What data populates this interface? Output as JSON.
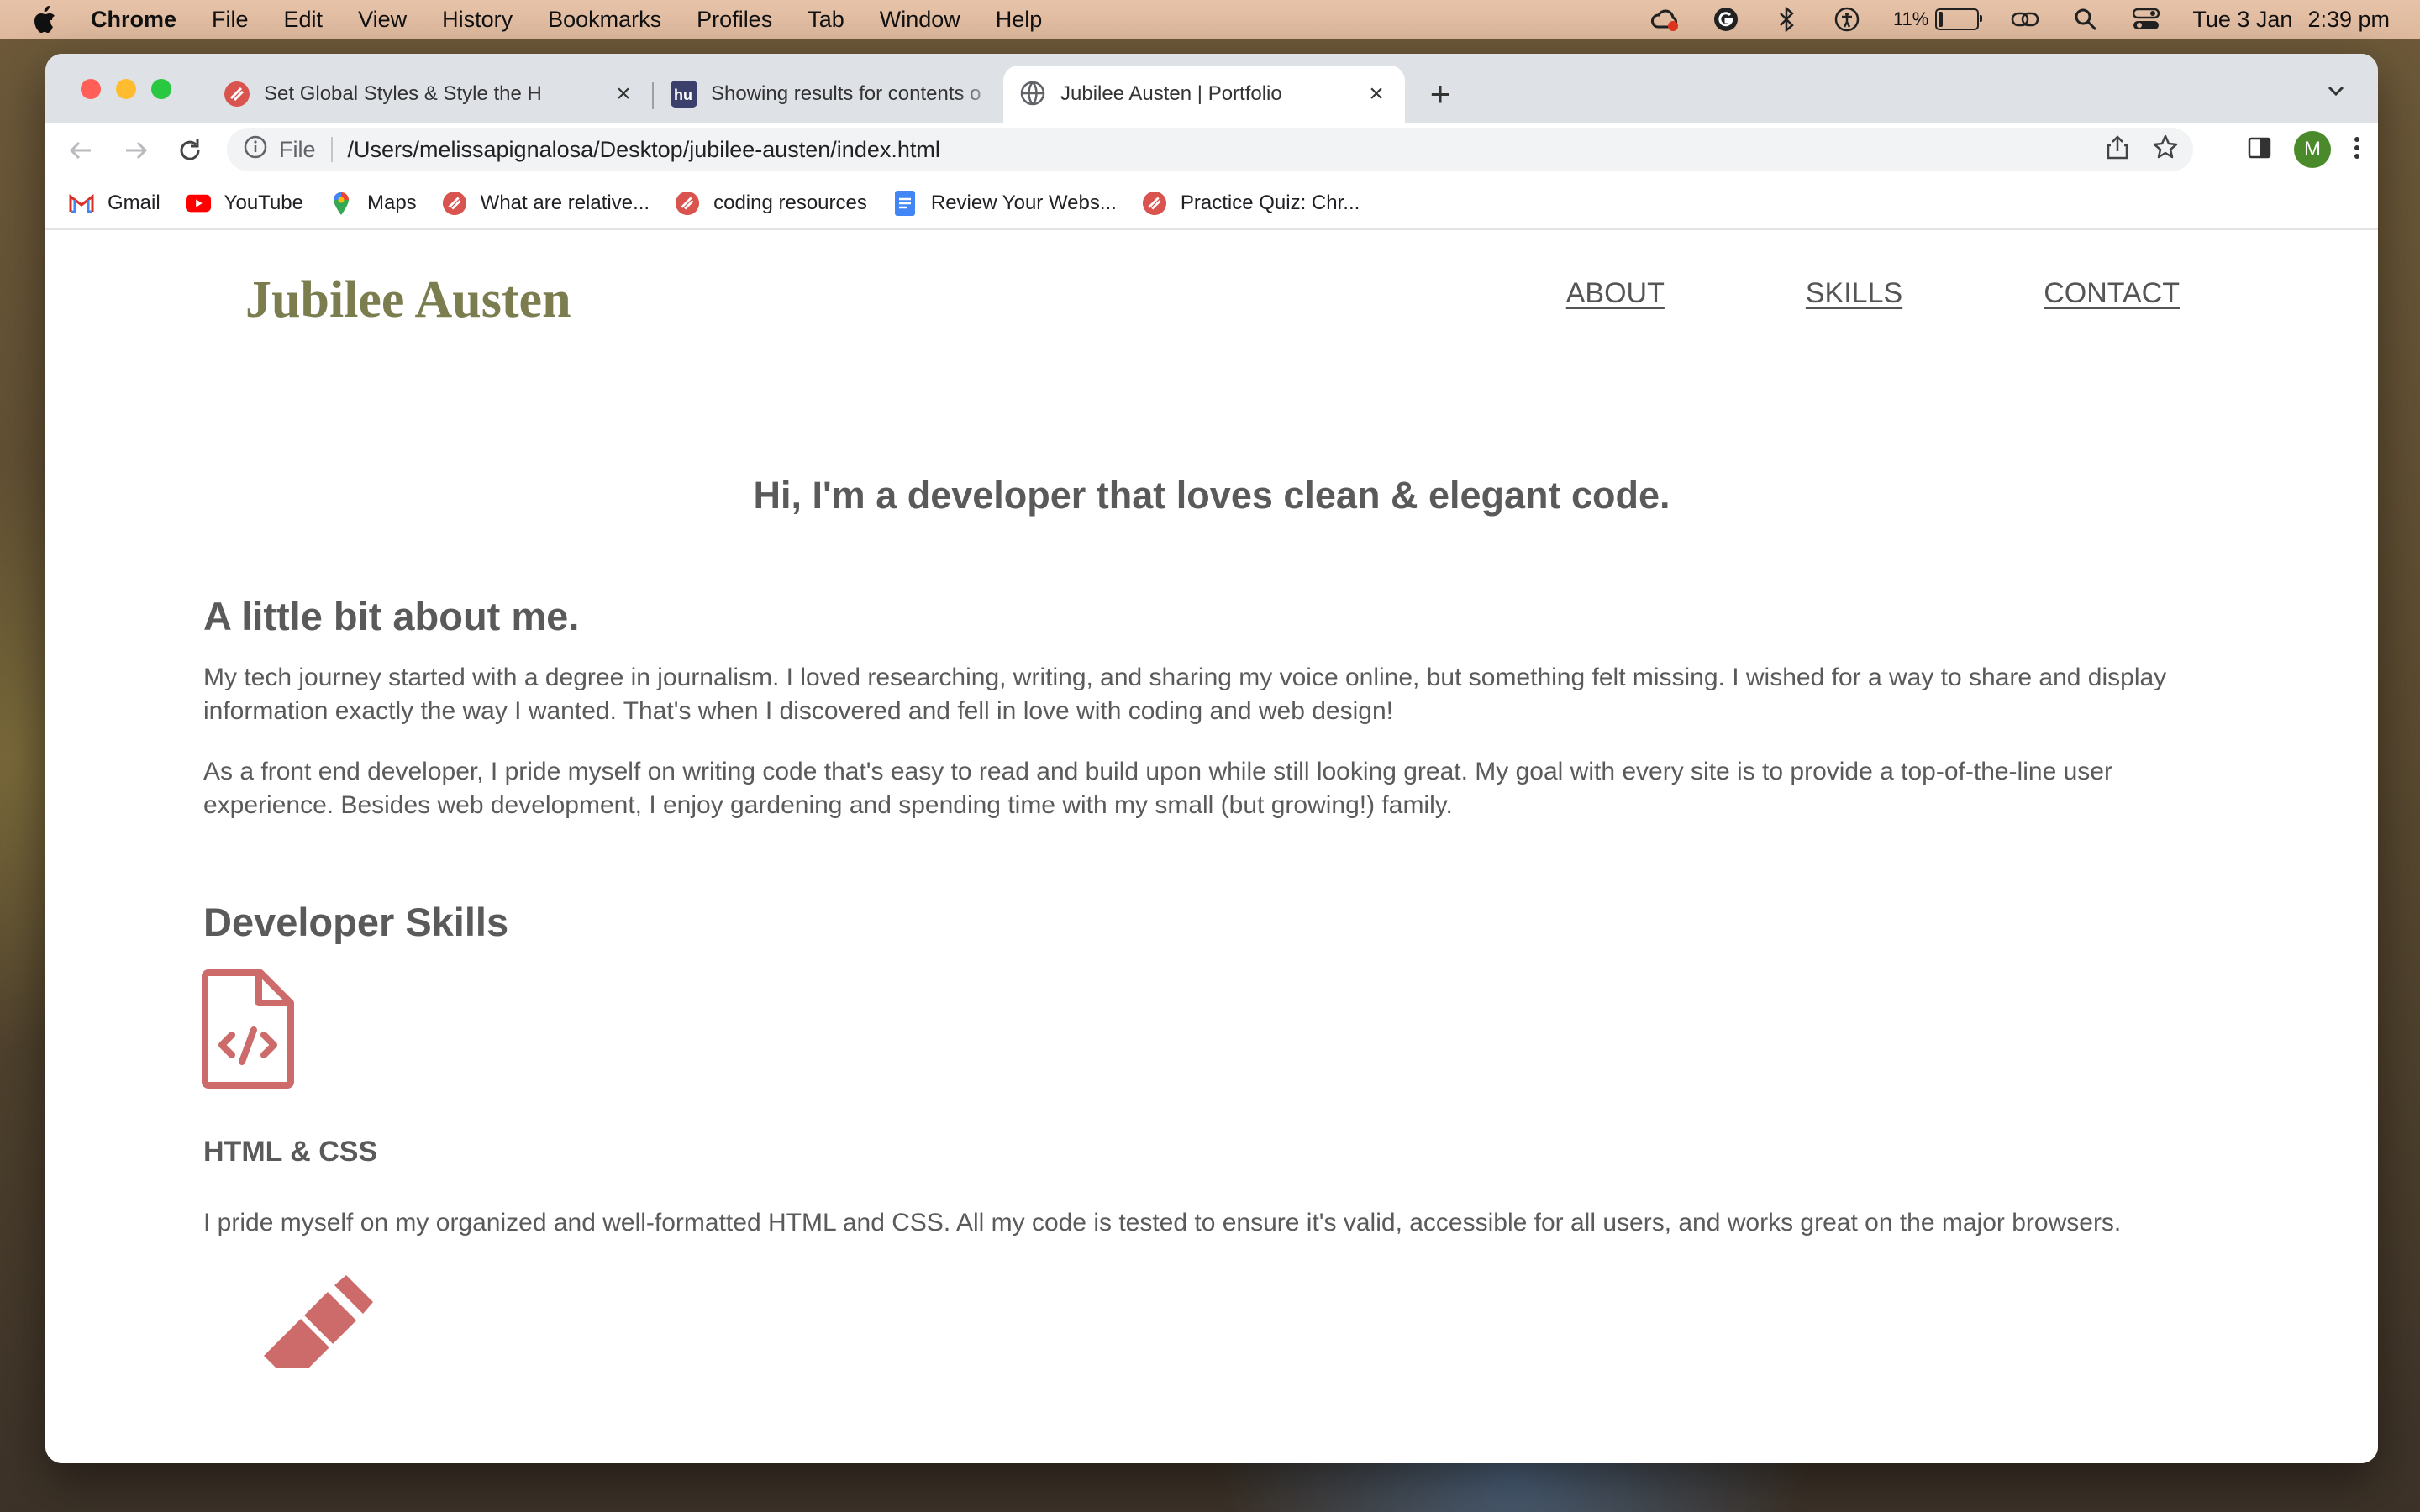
{
  "menubar": {
    "app": "Chrome",
    "items": [
      "File",
      "Edit",
      "View",
      "History",
      "Bookmarks",
      "Profiles",
      "Tab",
      "Window",
      "Help"
    ],
    "battery_percent": "11%",
    "battery_level": 0.11,
    "date": "Tue 3 Jan",
    "time": "2:39 pm"
  },
  "tabs": [
    {
      "label": "Set Global Styles & Style the H",
      "icon": "coding-dojo-icon",
      "active": false
    },
    {
      "label": "Showing results for contents o",
      "icon": "hu-icon",
      "active": false
    },
    {
      "label": "Jubilee Austen | Portfolio",
      "icon": "globe-icon",
      "active": true
    }
  ],
  "address": {
    "scheme": "File",
    "url": "/Users/melissapignalosa/Desktop/jubilee-austen/index.html"
  },
  "profile": {
    "initial": "M"
  },
  "bookmarks": [
    {
      "label": "Gmail",
      "icon": "gmail-icon"
    },
    {
      "label": "YouTube",
      "icon": "youtube-icon"
    },
    {
      "label": "Maps",
      "icon": "maps-icon"
    },
    {
      "label": "What are relative...",
      "icon": "coding-dojo-icon"
    },
    {
      "label": "coding resources",
      "icon": "coding-dojo-icon"
    },
    {
      "label": "Review Your Webs...",
      "icon": "docs-icon"
    },
    {
      "label": "Practice Quiz: Chr...",
      "icon": "coding-dojo-icon"
    }
  ],
  "site": {
    "title": "Jubilee Austen",
    "nav": [
      "ABOUT",
      "SKILLS",
      "CONTACT"
    ],
    "hero": "Hi, I'm a developer that loves clean & elegant code.",
    "about_heading": "A little bit about me.",
    "about_p1": "My tech journey started with a degree in journalism. I loved researching, writing, and sharing my voice online, but something felt missing. I wished for a way to share and display information exactly the way I wanted. That's when I discovered and fell in love with coding and web design!",
    "about_p2": "As a front end developer, I pride myself on writing code that's easy to read and build upon while still looking great. My goal with every site is to provide a top-of-the-line user experience. Besides web development, I enjoy gardening and spending time with my small (but growing!) family.",
    "skills_heading": "Developer Skills",
    "skills": [
      {
        "title": "HTML & CSS",
        "icon": "file-code-icon",
        "text": "I pride myself on my organized and well-formatted HTML and CSS. All my code is tested to ensure it's valid, accessible for all users, and works great on the major browsers."
      },
      {
        "icon": "pencil-icon"
      }
    ],
    "accent_color": "#7b7d4f",
    "icon_color": "#cd6b6b",
    "text_color": "#5a5a5a"
  }
}
